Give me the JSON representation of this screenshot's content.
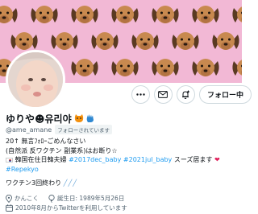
{
  "profile": {
    "display_name": "ゆりや☻유리야",
    "handle": "@ame_amane",
    "follows_you_badge": "フォローされています",
    "follow_button_label": "フォロー中",
    "bio_lines": [
      "20↑ 無言ﾌｫﾛｰごめんなさい",
      "(自然派 反ワクチン 副業系)はお断り☆",
      "韓国在住日韓夫婦",
      "スーズ居ます",
      "ワクチン3回終わり"
    ],
    "hashtags": [
      "#2017dec_baby",
      "#2021jul_baby",
      "#Repekyo"
    ],
    "location": "かんこく",
    "birthday": "誕生日: 1989年5月26日",
    "joined": "2010年8月からTwitterを利用しています"
  },
  "icons": {
    "more": "more-icon",
    "mail": "mail-icon",
    "notify": "bell-plus-icon",
    "location": "location-pin-icon",
    "birthday": "balloon-icon",
    "joined": "calendar-icon"
  },
  "colors": {
    "banner": "#f2b8d5",
    "link": "#1d9bf0",
    "muted": "#536471"
  }
}
